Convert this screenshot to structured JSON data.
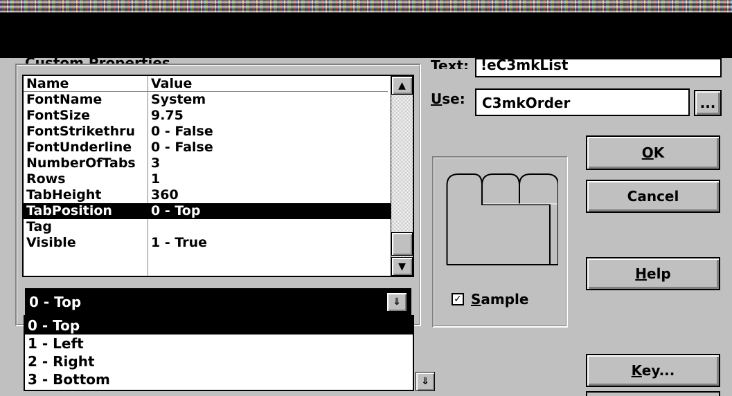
{
  "titlebar": {
    "noise_colors": [
      "#6a4a8c",
      "#3f7f3f",
      "#b04c4c",
      "#2d5f9e",
      "#c9b14a"
    ]
  },
  "group_label": "Custom Properties",
  "grid": {
    "headers": {
      "name": "Name",
      "value": "Value"
    },
    "rows": [
      {
        "name": "FontName",
        "value": "System"
      },
      {
        "name": "FontSize",
        "value": "9.75"
      },
      {
        "name": "FontStrikethru",
        "value": "0 - False"
      },
      {
        "name": "FontUnderline",
        "value": "0 - False"
      },
      {
        "name": "NumberOfTabs",
        "value": "3"
      },
      {
        "name": "Rows",
        "value": "1"
      },
      {
        "name": "TabHeight",
        "value": "360"
      },
      {
        "name": "TabPosition",
        "value": "0 - Top"
      },
      {
        "name": "Tag",
        "value": ""
      },
      {
        "name": "Visible",
        "value": "1 - True"
      }
    ],
    "selected_row": "TabPosition"
  },
  "value_combo": {
    "current": "0 - Top",
    "options": [
      "0 - Top",
      "1 - Left",
      "2 - Right",
      "3 - Bottom"
    ],
    "selected_option": "0 - Top"
  },
  "text_field": {
    "label": "Text:",
    "value": "!eC3mkList"
  },
  "use_field": {
    "label": "Use:",
    "value": "C3mkOrder",
    "browse_label": "..."
  },
  "buttons": {
    "ok": "OK",
    "cancel": "Cancel",
    "help": "Help",
    "key": "Key..."
  },
  "sample": {
    "label": "Sample",
    "checked": true,
    "check_glyph": "✓"
  },
  "arrows": {
    "up": "▲",
    "down": "▼",
    "combo_down": "⇓"
  }
}
